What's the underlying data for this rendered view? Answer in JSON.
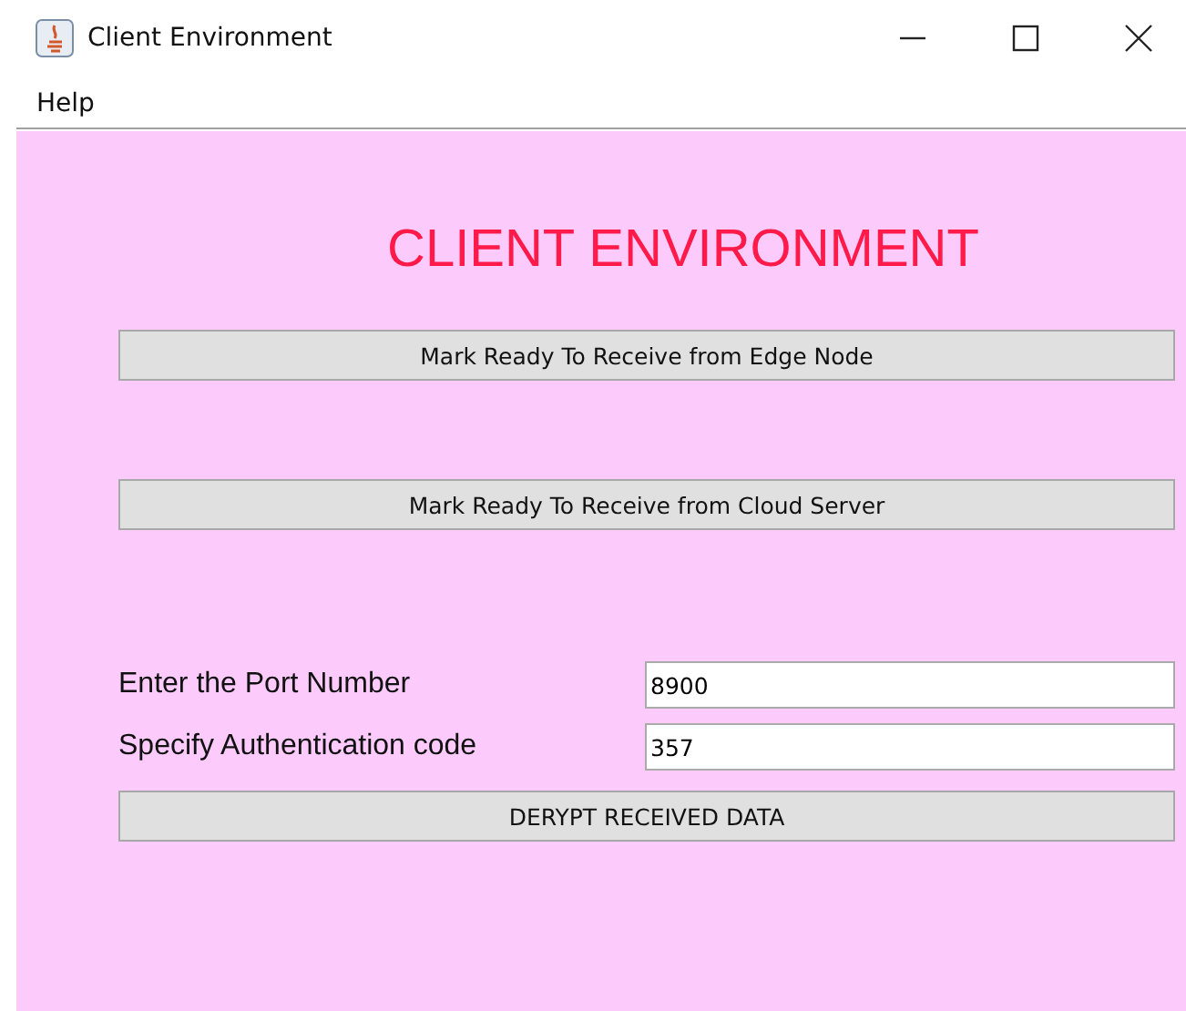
{
  "window": {
    "title": "Client Environment"
  },
  "menu": [
    "Help"
  ],
  "heading": "CLIENT ENVIRONMENT",
  "ready_buttons": [
    "Mark Ready To Receive from Edge Node",
    "Mark Ready To Receive from Cloud Server"
  ],
  "fields": [
    {
      "label": "Enter the Port Number",
      "value": "8900"
    },
    {
      "label": "Specify Authentication code",
      "value": "357"
    }
  ],
  "decrypt_button": "DERYPT RECEIVED DATA"
}
